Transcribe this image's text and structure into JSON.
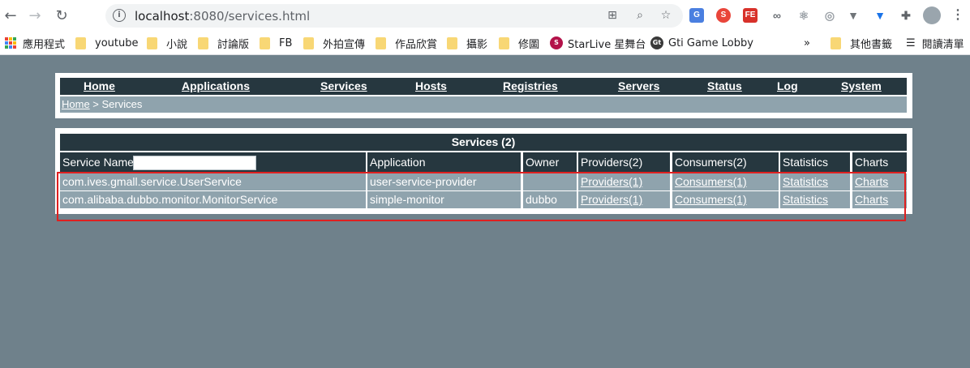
{
  "browser": {
    "url_host": "localhost",
    "url_rest": ":8080/services.html",
    "bookmarks": [
      "應用程式",
      "youtube",
      "小說",
      "討論版",
      "FB",
      "外拍宣傳",
      "作品欣賞",
      "攝影",
      "修圖",
      "StarLive 星舞台",
      "Gti Game Lobby"
    ],
    "overflow": "»",
    "other_bookmarks": "其他書籤",
    "reading_list": "閱讀清單"
  },
  "menu": {
    "items": [
      "Home",
      "Applications",
      "Services",
      "Hosts",
      "Registries",
      "Servers",
      "Status",
      "Log",
      "System"
    ]
  },
  "breadcrumb": {
    "home": "Home",
    "separator": " > ",
    "current": "Services"
  },
  "table": {
    "title": "Services (2)",
    "service_name_label": "Service Name:",
    "service_name_value": "",
    "headers": [
      "Application",
      "Owner",
      "Providers(2)",
      "Consumers(2)",
      "Statistics",
      "Charts"
    ],
    "rows": [
      {
        "service": "com.ives.gmall.service.UserService",
        "application": "user-service-provider",
        "owner": "",
        "providers": "Providers(1)",
        "consumers": "Consumers(1)",
        "statistics": "Statistics",
        "charts": "Charts"
      },
      {
        "service": "com.alibaba.dubbo.monitor.MonitorService",
        "application": "simple-monitor",
        "owner": "dubbo",
        "providers": "Providers(1)",
        "consumers": "Consumers(1)",
        "statistics": "Statistics",
        "charts": "Charts"
      }
    ]
  },
  "colors": {
    "page_bg": "#6f818b",
    "header_bg": "#26373f",
    "row_bg": "#8fa3ad",
    "highlight": "#e02020"
  }
}
